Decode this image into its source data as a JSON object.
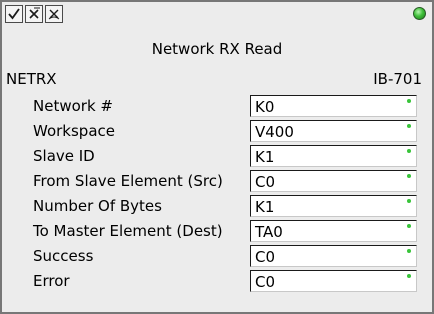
{
  "toolbar": {
    "buttons": [
      {
        "icon": "checkmark-icon"
      },
      {
        "icon": "cancel-x-icon"
      },
      {
        "icon": "help-x-icon"
      }
    ]
  },
  "status_indicator": {
    "color": "#3fbf39"
  },
  "title": "Network RX Read",
  "instruction": {
    "name": "NETRX",
    "id": "IB-701"
  },
  "params": [
    {
      "label": "Network #",
      "value": "K0"
    },
    {
      "label": "Workspace",
      "value": "V400"
    },
    {
      "label": "Slave ID",
      "value": "K1"
    },
    {
      "label": "From Slave Element (Src)",
      "value": "C0"
    },
    {
      "label": "Number Of Bytes",
      "value": "K1"
    },
    {
      "label": "To Master Element (Dest)",
      "value": "TA0"
    },
    {
      "label": "Success",
      "value": "C0"
    },
    {
      "label": "Error",
      "value": "C0"
    }
  ],
  "colors": {
    "background": "#ececec",
    "field_indicator": "#39c43a"
  }
}
